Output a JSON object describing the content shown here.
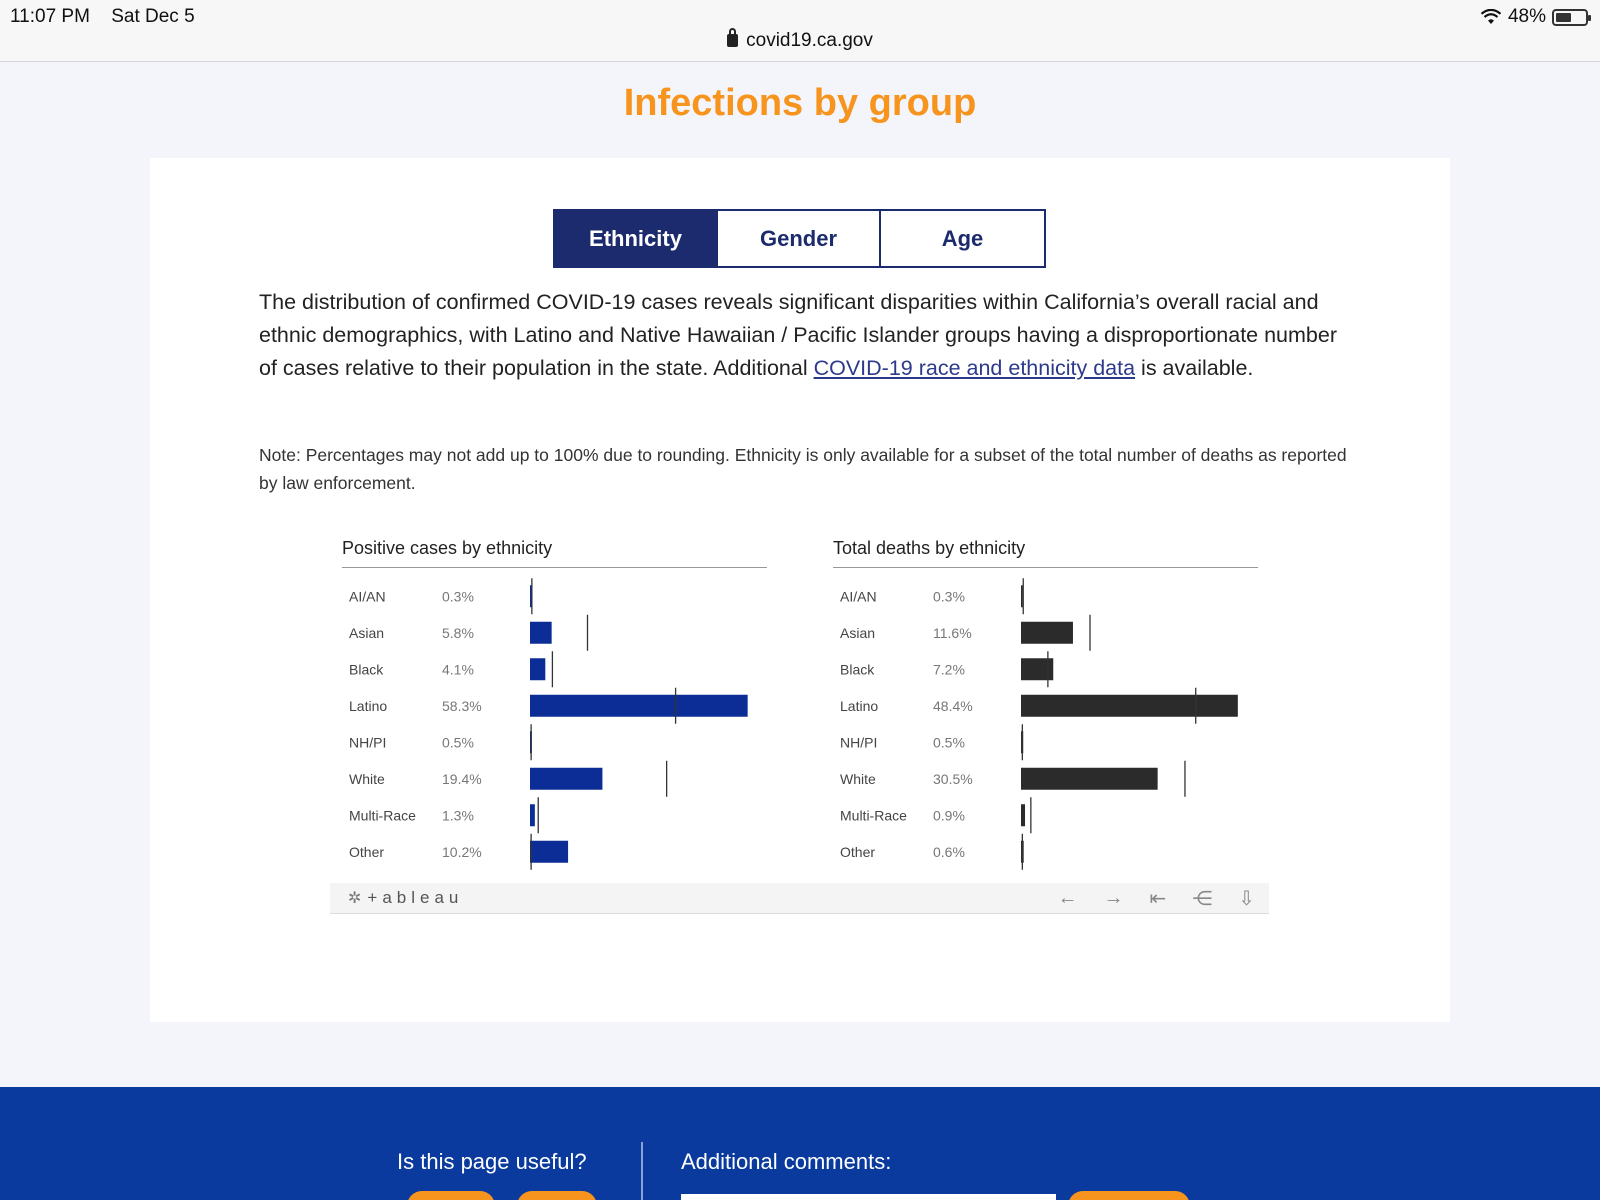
{
  "status": {
    "time": "11:07 PM",
    "date": "Sat Dec 5",
    "battery": "48%"
  },
  "url": "covid19.ca.gov",
  "page_title": "Infections by group",
  "tabs": [
    {
      "label": "Ethnicity",
      "active": true
    },
    {
      "label": "Gender",
      "active": false
    },
    {
      "label": "Age",
      "active": false
    }
  ],
  "description": {
    "before_link": "The distribution of confirmed COVID-19 cases reveals significant disparities within California’s overall racial and ethnic demographics, with Latino and Native Hawaiian / Pacific Islander groups having a disproportionate number of cases relative to their population in the state. Additional ",
    "link": "COVID-19 race and ethnicity data",
    "after_link": " is available."
  },
  "note": "Note: Percentages may not add up to 100% due to rounding. Ethnicity is only available for a subset of the total number of deaths as reported by law enforcement.",
  "colors": {
    "accent": "#f7941d",
    "navy": "#1c2b6e",
    "cases_bar": "#0d2d96",
    "deaths_bar": "#2b2b2b",
    "footer": "#0a3a9d"
  },
  "chart_data": [
    {
      "type": "bar",
      "title": "Positive cases by ethnicity",
      "categories": [
        "AI/AN",
        "Asian",
        "Black",
        "Latino",
        "NH/PI",
        "White",
        "Multi-Race",
        "Other"
      ],
      "labels": [
        "0.3%",
        "5.8%",
        "4.1%",
        "58.3%",
        "0.5%",
        "19.4%",
        "1.3%",
        "10.2%"
      ],
      "values": [
        0.3,
        5.8,
        4.1,
        58.3,
        0.5,
        19.4,
        1.3,
        10.2
      ],
      "reference_values": [
        0.5,
        15.4,
        6.0,
        39.0,
        0.3,
        36.6,
        2.2,
        0.3
      ],
      "xlim": [
        0,
        60
      ]
    },
    {
      "type": "bar",
      "title": "Total deaths by ethnicity",
      "categories": [
        "AI/AN",
        "Asian",
        "Black",
        "Latino",
        "NH/PI",
        "White",
        "Multi-Race",
        "Other"
      ],
      "labels": [
        "0.3%",
        "11.6%",
        "7.2%",
        "48.4%",
        "0.5%",
        "30.5%",
        "0.9%",
        "0.6%"
      ],
      "values": [
        0.3,
        11.6,
        7.2,
        48.4,
        0.5,
        30.5,
        0.9,
        0.6
      ],
      "reference_values": [
        0.5,
        15.4,
        6.0,
        39.0,
        0.3,
        36.6,
        2.2,
        0.3
      ],
      "xlim": [
        0,
        50
      ]
    }
  ],
  "tableau": {
    "logo": "+ableau"
  },
  "footer": {
    "question": "Is this page useful?",
    "comments": "Additional comments:"
  }
}
